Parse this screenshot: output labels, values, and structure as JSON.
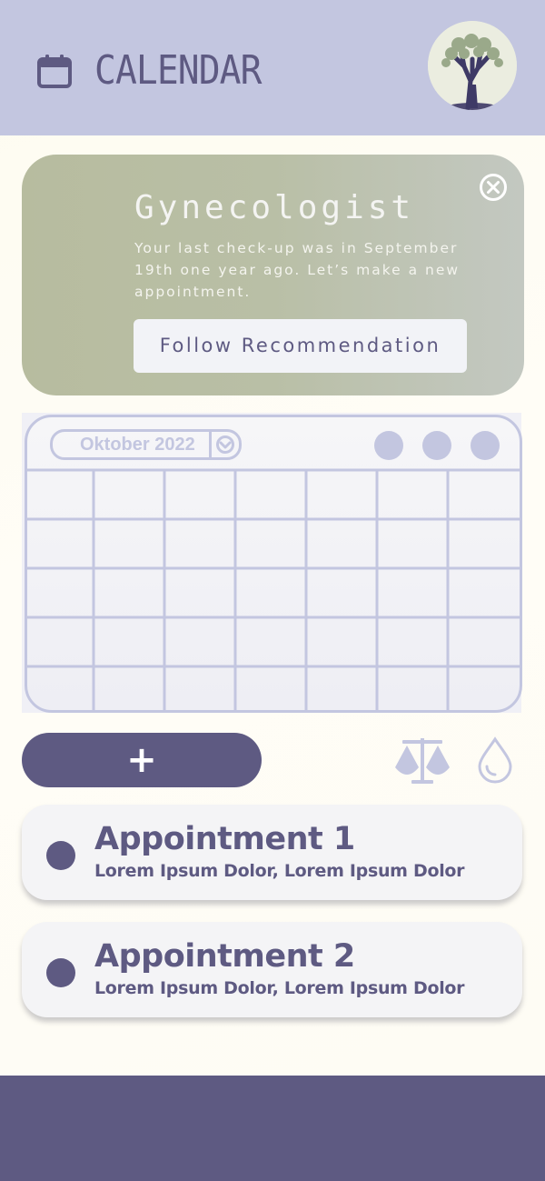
{
  "header": {
    "title": "CALENDAR",
    "icon": "calendar-icon",
    "avatar": "tree-avatar"
  },
  "recommendation": {
    "title": "Gynecologist",
    "text": "Your last check-up was in September 19th one year ago. Let’s make a new appointment.",
    "button_label": "Follow Recommendation",
    "close_icon": "close-circle-icon"
  },
  "calendar": {
    "month_label": "Oktober 2022",
    "dropdown_icon": "chevron-down-icon",
    "columns": 7,
    "rows": 5
  },
  "actions": {
    "add_label": "+",
    "scale_icon": "scale-icon",
    "drop_icon": "drop-icon"
  },
  "appointments": [
    {
      "title": "Appointment 1",
      "subtitle": "Lorem Ipsum Dolor, Lorem Ipsum Dolor"
    },
    {
      "title": "Appointment 2",
      "subtitle": "Lorem Ipsum Dolor, Lorem Ipsum Dolor"
    }
  ],
  "colors": {
    "primary": "#5e5a82",
    "header_bg": "#c3c6e0",
    "card_green": "#b7bc9f",
    "light": "#f4f4f6"
  }
}
